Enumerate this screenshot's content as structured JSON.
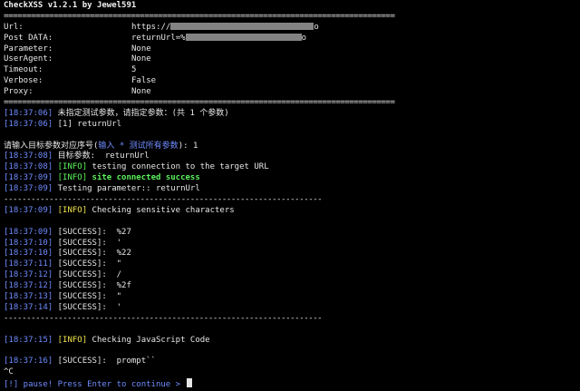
{
  "header": {
    "title": "CheckXSS v1.2.1 by Jewel591"
  },
  "separator_double": "======================================================================================",
  "config": {
    "url": {
      "label": "Url:",
      "value_a": "https://",
      "value_b": "o"
    },
    "post": {
      "label": "Post DATA:",
      "value_a": "returnUrl=%",
      "value_b": "o"
    },
    "parameter": {
      "label": "Parameter:",
      "value": "None"
    },
    "useragent": {
      "label": "UserAgent:",
      "value": "None"
    },
    "timeout": {
      "label": "Timeout:",
      "value": "5"
    },
    "verbose": {
      "label": "Verbose:",
      "value": "False"
    },
    "proxy": {
      "label": "Proxy:",
      "value": "None"
    }
  },
  "log1": [
    {
      "ts": "[18:37:06]",
      "text": " 未指定测试参数，请指定参数：(共 1 个参数)"
    },
    {
      "ts": "[18:37:06]",
      "text": " [1] returnUrl"
    }
  ],
  "prompt": {
    "prefix": "请输入目标参数对应序号(",
    "hint": "输入 * 测试所有参数",
    "suffix": "): 1"
  },
  "log2": {
    "target": {
      "ts": "[18:37:08]",
      "text": " 目标参数:  returnUrl"
    },
    "testing": {
      "ts": "[18:37:08]",
      "tag": "[INFO]",
      "text": " testing connection to the target URL"
    },
    "connected": {
      "ts": "[18:37:09]",
      "tag": "[INFO]",
      "text": " site connected success"
    },
    "param": {
      "ts": "[18:37:09]",
      "text": " Testing parameter:: returnUrl"
    }
  },
  "separator_dash": "----------------------------------------------------------------------",
  "sensitive": {
    "ts": "[18:37:09]",
    "tag": "[INFO]",
    "text": " Checking sensitive characters"
  },
  "success_rows": [
    {
      "ts": "[18:37:09]",
      "text": " [SUCCESS]:  %27"
    },
    {
      "ts": "[18:37:10]",
      "text": " [SUCCESS]:  '"
    },
    {
      "ts": "[18:37:10]",
      "text": " [SUCCESS]:  %22"
    },
    {
      "ts": "[18:37:11]",
      "text": " [SUCCESS]:  \""
    },
    {
      "ts": "[18:37:12]",
      "text": " [SUCCESS]:  /"
    },
    {
      "ts": "[18:37:12]",
      "text": " [SUCCESS]:  %2f"
    },
    {
      "ts": "[18:37:13]",
      "text": " [SUCCESS]:  \""
    },
    {
      "ts": "[18:37:14]",
      "text": " [SUCCESS]:  '"
    }
  ],
  "js": {
    "ts": "[18:37:15]",
    "tag": "[INFO]",
    "text": " Checking JavaScript Code"
  },
  "js_success": {
    "ts": "[18:37:16]",
    "text": " [SUCCESS]:  prompt``"
  },
  "ctrl_c": "^C",
  "pause": "[!] pause! Press Enter to continue > "
}
